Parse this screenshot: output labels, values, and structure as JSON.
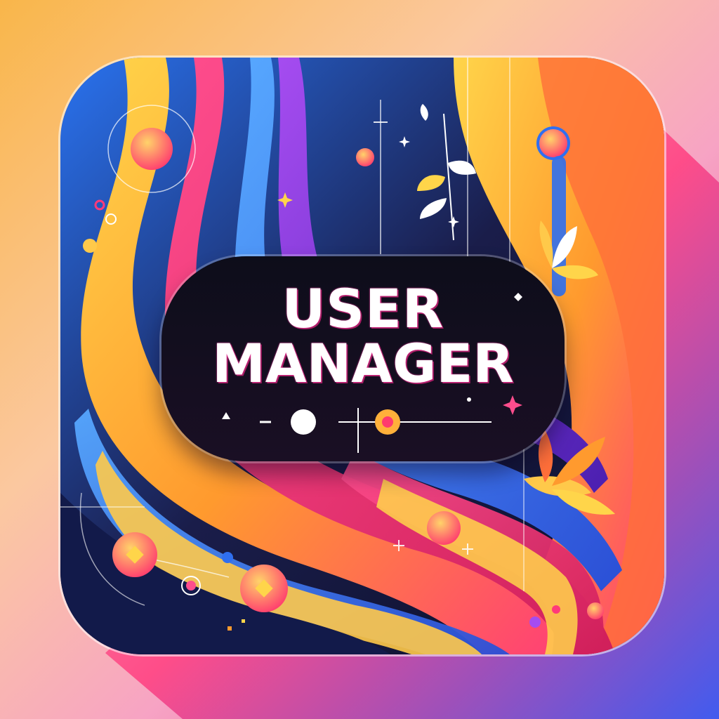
{
  "title": {
    "line1": "USER",
    "line2": "MANAGER"
  },
  "colors": {
    "pill_background": "#0d0d1a",
    "text": "#ffffff",
    "accent_pink": "#ff3a7a",
    "accent_blue": "#2f6ff0",
    "accent_orange": "#ff9a2e",
    "accent_yellow": "#ffd23f",
    "accent_purple": "#7a2ff0"
  },
  "icons": [
    "circle-dot-icon",
    "diamond-icon",
    "leaf-icon",
    "sparkle-icon",
    "plus-icon"
  ]
}
